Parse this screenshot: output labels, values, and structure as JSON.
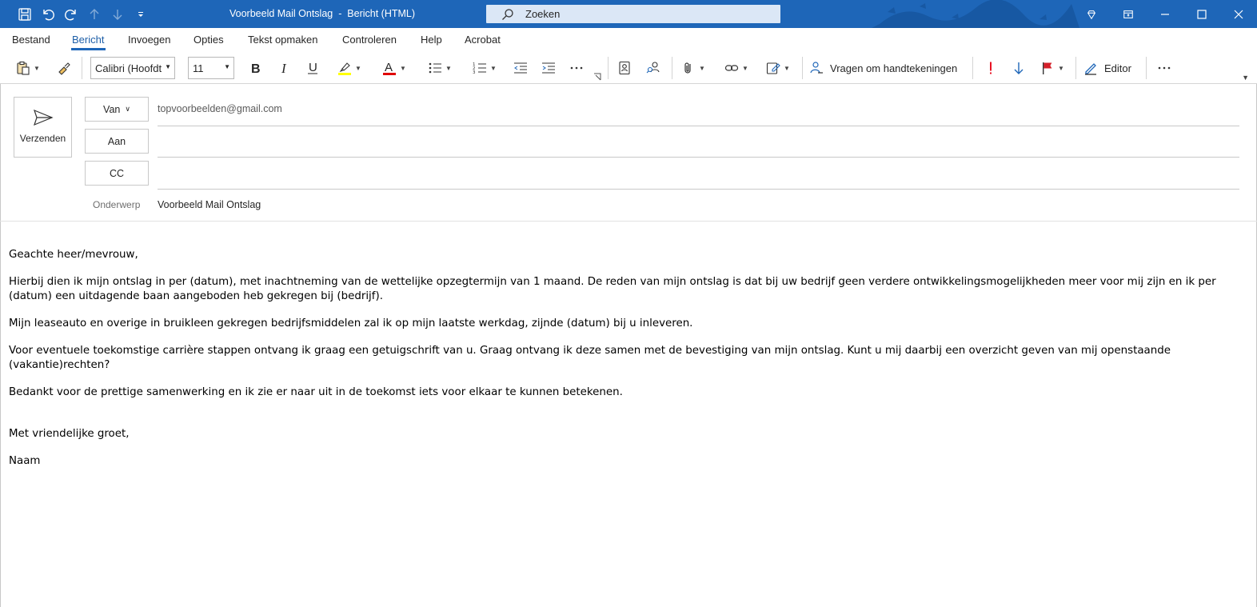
{
  "titlebar": {
    "title": "Voorbeeld Mail Ontslag  -  Bericht (HTML)",
    "search_label": "Zoeken",
    "accent_color": "#1e66b8"
  },
  "tabs": [
    {
      "label": "Bestand"
    },
    {
      "label": "Bericht",
      "active": true
    },
    {
      "label": "Invoegen"
    },
    {
      "label": "Opties"
    },
    {
      "label": "Tekst opmaken"
    },
    {
      "label": "Controleren"
    },
    {
      "label": "Help"
    },
    {
      "label": "Acrobat"
    }
  ],
  "ribbon": {
    "font_name": "Calibri (Hoofdt",
    "font_size": "11",
    "signatures_label": "Vragen om handtekeningen",
    "editor_label": "Editor",
    "highlight_color": "#ffff00",
    "font_color": "#e00000"
  },
  "compose": {
    "send_label": "Verzenden",
    "from_label": "Van",
    "from_value": "topvoorbeelden@gmail.com",
    "to_label": "Aan",
    "to_value": "",
    "cc_label": "CC",
    "cc_value": "",
    "subject_label": "Onderwerp",
    "subject_value": "Voorbeeld Mail Ontslag"
  },
  "body": {
    "greeting": "Geachte heer/mevrouw,",
    "p1": "Hierbij dien ik mijn ontslag in per (datum), met inachtneming van de wettelijke opzegtermijn van 1 maand. De reden van mijn ontslag is dat bij uw bedrijf geen verdere ontwikkelingsmogelijkheden meer voor mij zijn en ik per (datum) een uitdagende baan aangeboden heb gekregen bij (bedrijf).",
    "p2": "Mijn leaseauto en overige in bruikleen gekregen bedrijfsmiddelen zal ik op mijn laatste werkdag, zijnde (datum) bij u inleveren.",
    "p3": "Voor eventuele toekomstige carrière stappen ontvang ik graag een getuigschrift van u. Graag ontvang ik deze samen met de bevestiging van mijn ontslag. Kunt u mij daarbij een overzicht geven van mij openstaande (vakantie)rechten?",
    "p4": "Bedankt voor de prettige samenwerking en ik zie er naar uit in de toekomst iets voor elkaar te kunnen betekenen.",
    "closing": "Met vriendelijke groet,",
    "name": "Naam"
  }
}
